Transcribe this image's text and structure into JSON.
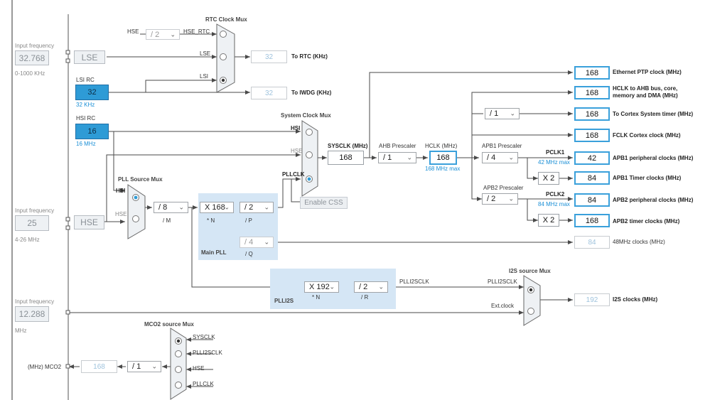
{
  "rtc": {
    "mux_title": "RTC Clock Mux",
    "hse_label": "HSE",
    "hse_div": "/ 2",
    "hse_rtc_label": "HSE_RTC",
    "lse_label": "LSE",
    "lsi_label": "LSI",
    "out_value": "32",
    "out_label": "To RTC (KHz)",
    "iwdg_value": "32",
    "iwdg_label": "To IWDG (KHz)"
  },
  "lse": {
    "input_caption": "Input frequency",
    "input_value": "32.768",
    "range": "0-1000 KHz",
    "box": "LSE"
  },
  "lsi": {
    "title": "LSI RC",
    "value": "32",
    "sub": "32 KHz"
  },
  "hsi": {
    "title": "HSI RC",
    "value": "16",
    "sub": "16 MHz"
  },
  "hse": {
    "input_caption": "Input frequency",
    "input_value": "25",
    "range": "4-26 MHz",
    "box": "HSE"
  },
  "pll_source_mux": {
    "title": "PLL Source Mux",
    "hsi": "HSI",
    "hse": "HSE"
  },
  "main_pll": {
    "m_value": "/ 8",
    "m_label": "/ M",
    "n_value": "X 168",
    "n_label": "* N",
    "p_value": "/ 2",
    "p_label": "/ P",
    "q_value": "/ 4",
    "q_label": "/ Q",
    "title": "Main PLL"
  },
  "system_clock_mux": {
    "title": "System Clock Mux",
    "hsi": "HSI",
    "hse": "HSE",
    "pllclk": "PLLCLK",
    "enable_css": "Enable CSS"
  },
  "sysclk": {
    "label": "SYSCLK (MHz)",
    "value": "168"
  },
  "ahb": {
    "label": "AHB Prescaler",
    "value": "/ 1"
  },
  "hclk": {
    "label": "HCLK (MHz)",
    "value": "168",
    "max": "168 MHz max"
  },
  "cortex_div": "/ 1",
  "apb1": {
    "label": "APB1 Prescaler",
    "value": "/ 4",
    "pclk_label": "PCLK1",
    "max": "42 MHz max",
    "x2": "X 2"
  },
  "apb2": {
    "label": "APB2 Prescaler",
    "value": "/ 2",
    "pclk_label": "PCLK2",
    "max": "84 MHz max",
    "x2": "X 2"
  },
  "outputs": [
    {
      "value": "168",
      "label": "Ethernet PTP clock (MHz)"
    },
    {
      "value": "168",
      "label": "HCLK to AHB bus, core,",
      "label2": "memory and DMA (MHz)"
    },
    {
      "value": "168",
      "label": "To Cortex System timer (MHz)"
    },
    {
      "value": "168",
      "label": "FCLK Cortex clock (MHz)"
    },
    {
      "value": "42",
      "label": "APB1 peripheral clocks (MHz)"
    },
    {
      "value": "84",
      "label": "APB1 Timer clocks (MHz)"
    },
    {
      "value": "84",
      "label": "APB2 peripheral clocks (MHz)"
    },
    {
      "value": "168",
      "label": "APB2 timer clocks (MHz)"
    },
    {
      "value": "84",
      "label": "48MHz clocks (MHz)"
    }
  ],
  "plli2s": {
    "n_value": "X 192",
    "n_label": "* N",
    "r_value": "/ 2",
    "r_label": "/ R",
    "title": "PLLI2S",
    "out_label": "PLLI2SCLK"
  },
  "i2s": {
    "mux_title": "I2S source Mux",
    "plli2sclk": "PLLI2SCLK",
    "ext": "Ext.clock",
    "value": "192",
    "label": "I2S clocks (MHz)"
  },
  "ext_input": {
    "input_caption": "Input frequency",
    "input_value": "12.288",
    "unit": "MHz"
  },
  "mco2": {
    "mux_title": "MCO2 source Mux",
    "sysclk": "SYSCLK",
    "plli2sclk": "PLLI2SCLK",
    "hse": "HSE",
    "pllclk": "PLLCLK",
    "div": "/ 1",
    "value": "168",
    "label": "(MHz) MCO2"
  },
  "colors": {
    "accent": "#3aa0db",
    "source_fill": "#2e9bd6",
    "region": "#d5e6f5",
    "wire": "#4a4a4a"
  }
}
